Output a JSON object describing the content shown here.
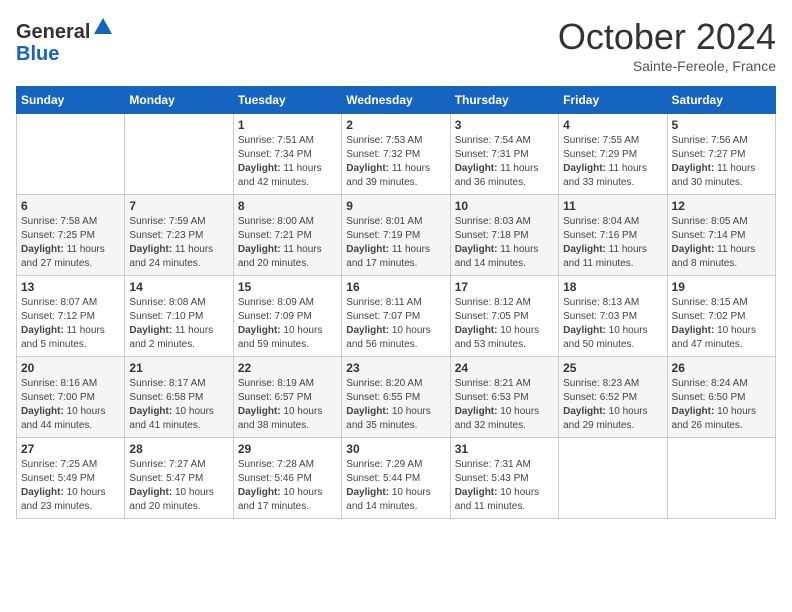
{
  "header": {
    "logo_general": "General",
    "logo_blue": "Blue",
    "month": "October 2024",
    "location": "Sainte-Fereole, France"
  },
  "days_of_week": [
    "Sunday",
    "Monday",
    "Tuesday",
    "Wednesday",
    "Thursday",
    "Friday",
    "Saturday"
  ],
  "weeks": [
    [
      {
        "day": "",
        "info": ""
      },
      {
        "day": "",
        "info": ""
      },
      {
        "day": "1",
        "info": "Sunrise: 7:51 AM\nSunset: 7:34 PM\nDaylight: 11 hours and 42 minutes."
      },
      {
        "day": "2",
        "info": "Sunrise: 7:53 AM\nSunset: 7:32 PM\nDaylight: 11 hours and 39 minutes."
      },
      {
        "day": "3",
        "info": "Sunrise: 7:54 AM\nSunset: 7:31 PM\nDaylight: 11 hours and 36 minutes."
      },
      {
        "day": "4",
        "info": "Sunrise: 7:55 AM\nSunset: 7:29 PM\nDaylight: 11 hours and 33 minutes."
      },
      {
        "day": "5",
        "info": "Sunrise: 7:56 AM\nSunset: 7:27 PM\nDaylight: 11 hours and 30 minutes."
      }
    ],
    [
      {
        "day": "6",
        "info": "Sunrise: 7:58 AM\nSunset: 7:25 PM\nDaylight: 11 hours and 27 minutes."
      },
      {
        "day": "7",
        "info": "Sunrise: 7:59 AM\nSunset: 7:23 PM\nDaylight: 11 hours and 24 minutes."
      },
      {
        "day": "8",
        "info": "Sunrise: 8:00 AM\nSunset: 7:21 PM\nDaylight: 11 hours and 20 minutes."
      },
      {
        "day": "9",
        "info": "Sunrise: 8:01 AM\nSunset: 7:19 PM\nDaylight: 11 hours and 17 minutes."
      },
      {
        "day": "10",
        "info": "Sunrise: 8:03 AM\nSunset: 7:18 PM\nDaylight: 11 hours and 14 minutes."
      },
      {
        "day": "11",
        "info": "Sunrise: 8:04 AM\nSunset: 7:16 PM\nDaylight: 11 hours and 11 minutes."
      },
      {
        "day": "12",
        "info": "Sunrise: 8:05 AM\nSunset: 7:14 PM\nDaylight: 11 hours and 8 minutes."
      }
    ],
    [
      {
        "day": "13",
        "info": "Sunrise: 8:07 AM\nSunset: 7:12 PM\nDaylight: 11 hours and 5 minutes."
      },
      {
        "day": "14",
        "info": "Sunrise: 8:08 AM\nSunset: 7:10 PM\nDaylight: 11 hours and 2 minutes."
      },
      {
        "day": "15",
        "info": "Sunrise: 8:09 AM\nSunset: 7:09 PM\nDaylight: 10 hours and 59 minutes."
      },
      {
        "day": "16",
        "info": "Sunrise: 8:11 AM\nSunset: 7:07 PM\nDaylight: 10 hours and 56 minutes."
      },
      {
        "day": "17",
        "info": "Sunrise: 8:12 AM\nSunset: 7:05 PM\nDaylight: 10 hours and 53 minutes."
      },
      {
        "day": "18",
        "info": "Sunrise: 8:13 AM\nSunset: 7:03 PM\nDaylight: 10 hours and 50 minutes."
      },
      {
        "day": "19",
        "info": "Sunrise: 8:15 AM\nSunset: 7:02 PM\nDaylight: 10 hours and 47 minutes."
      }
    ],
    [
      {
        "day": "20",
        "info": "Sunrise: 8:16 AM\nSunset: 7:00 PM\nDaylight: 10 hours and 44 minutes."
      },
      {
        "day": "21",
        "info": "Sunrise: 8:17 AM\nSunset: 6:58 PM\nDaylight: 10 hours and 41 minutes."
      },
      {
        "day": "22",
        "info": "Sunrise: 8:19 AM\nSunset: 6:57 PM\nDaylight: 10 hours and 38 minutes."
      },
      {
        "day": "23",
        "info": "Sunrise: 8:20 AM\nSunset: 6:55 PM\nDaylight: 10 hours and 35 minutes."
      },
      {
        "day": "24",
        "info": "Sunrise: 8:21 AM\nSunset: 6:53 PM\nDaylight: 10 hours and 32 minutes."
      },
      {
        "day": "25",
        "info": "Sunrise: 8:23 AM\nSunset: 6:52 PM\nDaylight: 10 hours and 29 minutes."
      },
      {
        "day": "26",
        "info": "Sunrise: 8:24 AM\nSunset: 6:50 PM\nDaylight: 10 hours and 26 minutes."
      }
    ],
    [
      {
        "day": "27",
        "info": "Sunrise: 7:25 AM\nSunset: 5:49 PM\nDaylight: 10 hours and 23 minutes."
      },
      {
        "day": "28",
        "info": "Sunrise: 7:27 AM\nSunset: 5:47 PM\nDaylight: 10 hours and 20 minutes."
      },
      {
        "day": "29",
        "info": "Sunrise: 7:28 AM\nSunset: 5:46 PM\nDaylight: 10 hours and 17 minutes."
      },
      {
        "day": "30",
        "info": "Sunrise: 7:29 AM\nSunset: 5:44 PM\nDaylight: 10 hours and 14 minutes."
      },
      {
        "day": "31",
        "info": "Sunrise: 7:31 AM\nSunset: 5:43 PM\nDaylight: 10 hours and 11 minutes."
      },
      {
        "day": "",
        "info": ""
      },
      {
        "day": "",
        "info": ""
      }
    ]
  ]
}
